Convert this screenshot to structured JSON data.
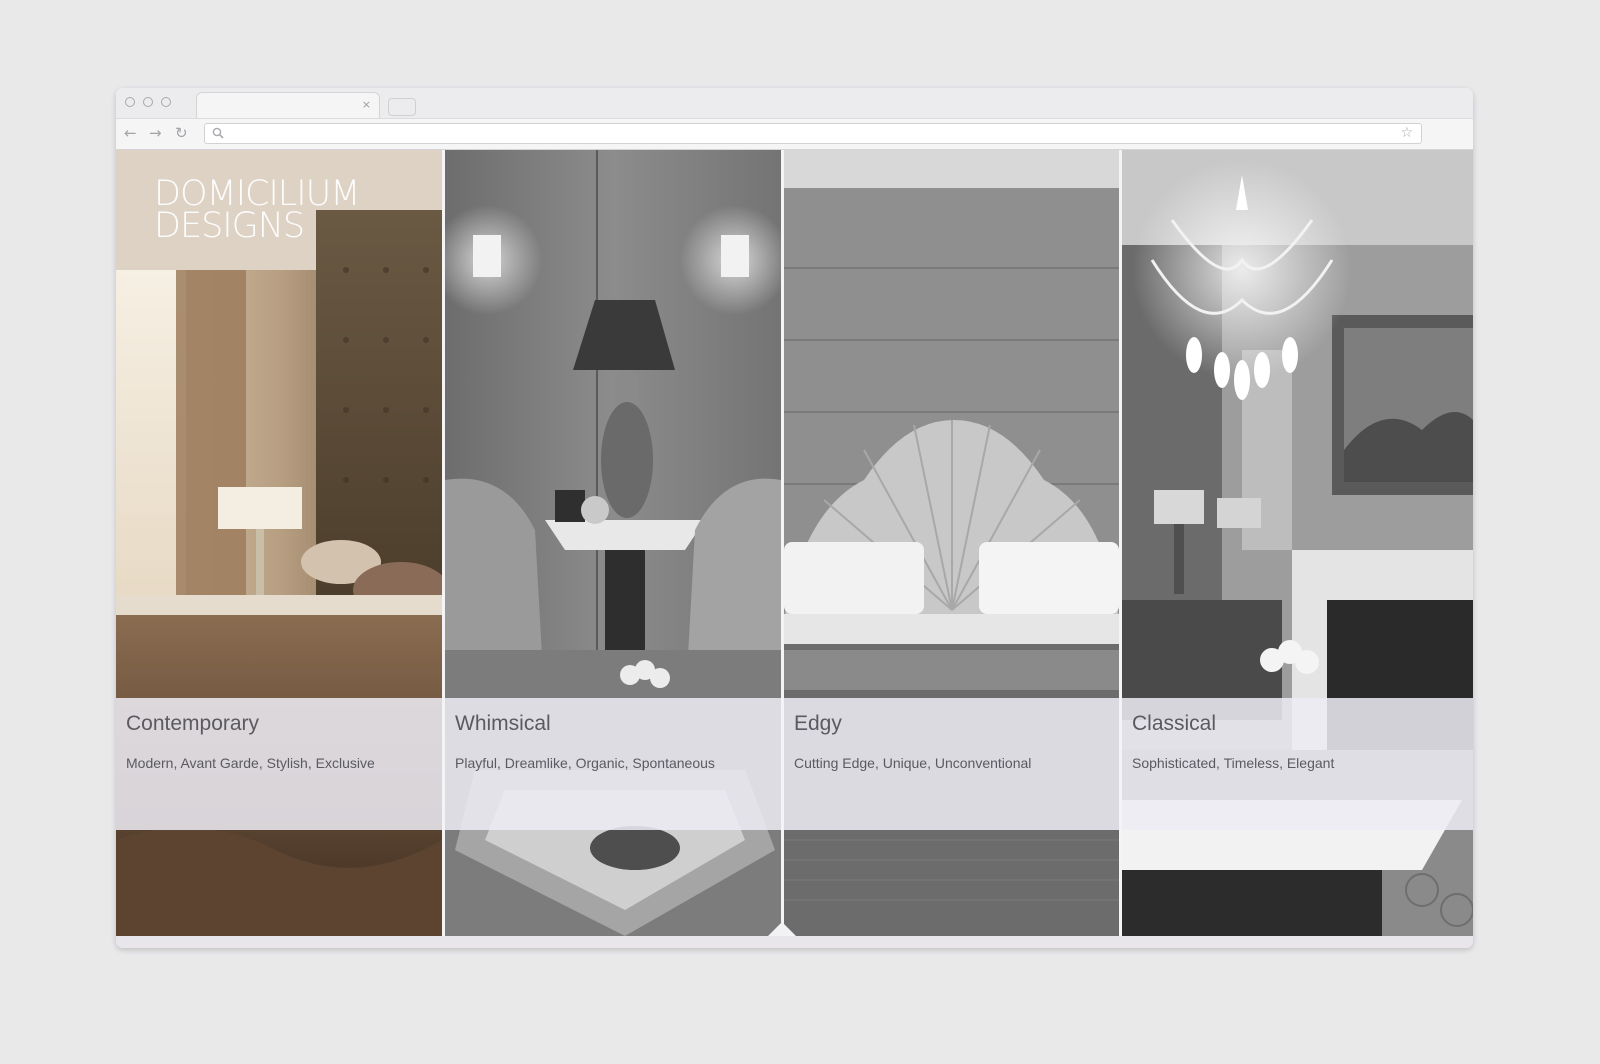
{
  "browser": {
    "tab_close": "×",
    "back_icon": "←",
    "forward_icon": "→",
    "reload_icon": "↻",
    "star_icon": "☆",
    "address_value": ""
  },
  "site": {
    "logo_line1": "DOMICILIUM",
    "logo_line2": "DESIGNS"
  },
  "panels": [
    {
      "title": "Contemporary",
      "subtitle": "Modern, Avant Garde, Stylish, Exclusive"
    },
    {
      "title": "Whimsical",
      "subtitle": "Playful, Dreamlike, Organic, Spontaneous"
    },
    {
      "title": "Edgy",
      "subtitle": "Cutting Edge, Unique, Unconventional"
    },
    {
      "title": "Classical",
      "subtitle": "Sophisticated, Timeless, Elegant"
    }
  ],
  "colors": {
    "caption_overlay": "#eeecf4",
    "caption_text": "#5a5a60",
    "browser_chrome": "#ececee"
  }
}
